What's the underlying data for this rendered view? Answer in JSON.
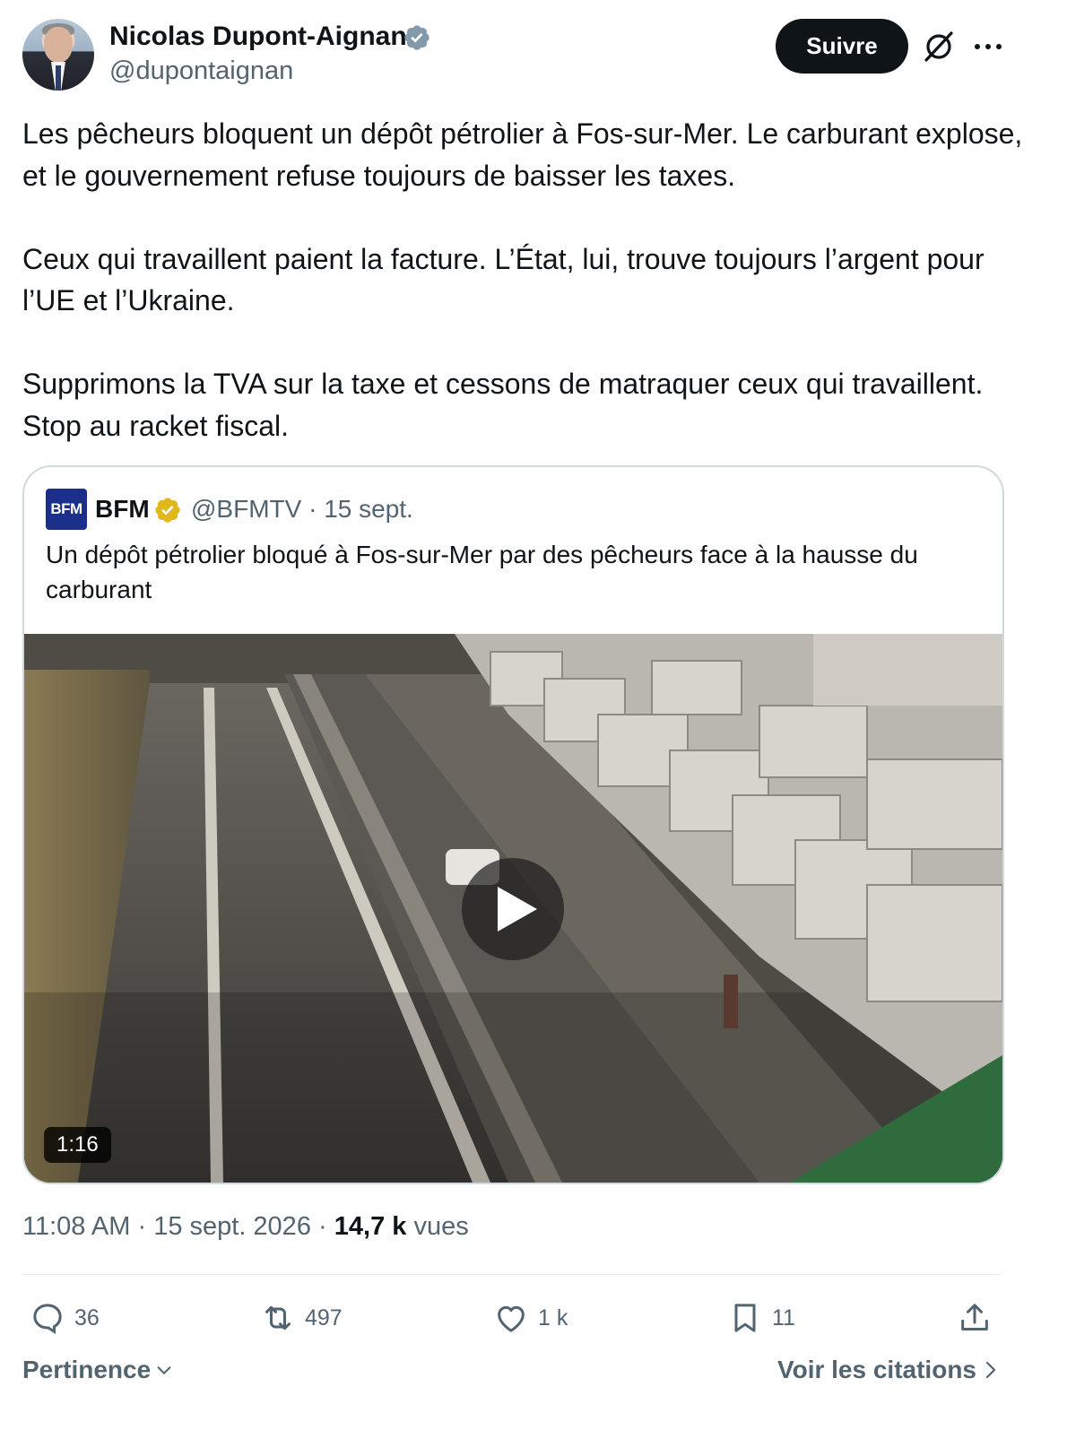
{
  "author": {
    "name": "Nicolas Dupont-Aignan",
    "handle": "@dupontaignan",
    "verified_badge_color": "#829aab"
  },
  "header": {
    "follow_label": "Suivre",
    "icons": [
      "grok-icon",
      "more-icon"
    ]
  },
  "tweet": {
    "paragraphs": [
      "Les pêcheurs bloquent un dépôt pétrolier à Fos-sur-Mer. Le carburant explose, et le gouvernement refuse toujours de baisser les taxes.",
      "Ceux qui travaillent paient la facture. L’État, lui, trouve toujours l’argent pour l’UE et l’Ukraine.",
      "Supprimons la TVA sur la taxe et cessons de matraquer ceux qui travaillent. Stop au racket fiscal."
    ]
  },
  "quote": {
    "logo_text": "BFM",
    "name": "BFM",
    "handle": "@BFMTV",
    "separator": "·",
    "date": "15 sept.",
    "text": "Un dépôt pétrolier bloqué à Fos-sur-Mer par des pêcheurs face à la hausse du carburant",
    "verified_badge_color": "#e2b719",
    "video": {
      "duration": "1:16"
    }
  },
  "meta": {
    "time": "11:08 AM",
    "separator": "·",
    "date": "15 sept. 2026",
    "views_count": "14,7 k",
    "views_label": "vues"
  },
  "actions": {
    "replies": "36",
    "reposts": "497",
    "likes": "1 k",
    "bookmarks": "11"
  },
  "footer": {
    "sort_label": "Pertinence",
    "quotes_label": "Voir les citations"
  },
  "colors": {
    "text_primary": "#0f1419",
    "text_secondary": "#536471",
    "border": "#cfd9de",
    "follow_bg": "#0f1419"
  }
}
